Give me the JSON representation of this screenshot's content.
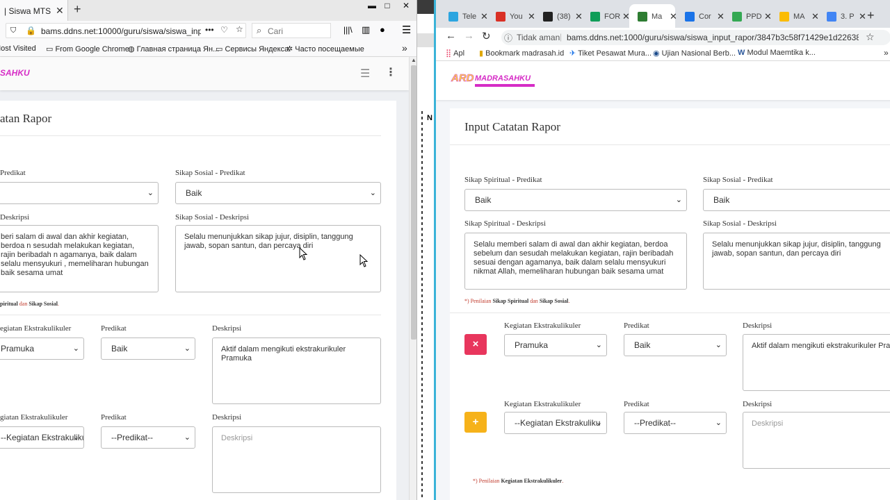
{
  "firefox": {
    "tab_title": "| Siswa MTS",
    "url": "bams.ddns.net:10000/guru/siswa/siswa_input_",
    "search_placeholder": "Cari",
    "bookmarks": [
      "Most Visited",
      "From Google Chrome",
      "Главная страница Ян...",
      "Сервисы Яндекса",
      "Часто посещаемые"
    ],
    "logo": "SAHKU",
    "page_title": "atan Rapor",
    "label_spiritual_predikat": "Predikat",
    "label_sosial_predikat": "Sikap Sosial - Predikat",
    "sosial_predikat_value": "Baik",
    "label_spiritual_deskripsi": "Deskripsi",
    "label_sosial_deskripsi": "Sikap Sosial - Deskripsi",
    "spiritual_deskripsi": "beri salam di awal dan akhir kegiatan, berdoa n sesudah melakukan kegiatan, rajin beribadah n agamanya, baik dalam selalu mensyukuri , memeliharan hubungan baik sesama umat",
    "sosial_deskripsi": "Selalu menunjukkan sikap jujur, disiplin, tanggung jawab, sopan santun, dan percaya diri",
    "note_sikap_bold": "piritual",
    "note_sikap_mid": " dan ",
    "note_sikap_bold2": "Sikap Sosial",
    "note_sikap_end": ".",
    "ekskul_rows": [
      {
        "label_kegiatan": "egiatan Ekstrakulikuler",
        "label_predikat": "Predikat",
        "label_deskripsi": "Deskripsi",
        "kegiatan": "Pramuka",
        "predikat": "Baik",
        "deskripsi": "Aktif dalam mengikuti ekstrakurikuler Pramuka"
      },
      {
        "label_kegiatan": "giatan Ekstrakulikuler",
        "label_predikat": "Predikat",
        "label_deskripsi": "Deskripsi",
        "kegiatan": "--Kegiatan Ekstrakuliku",
        "predikat": "--Predikat--",
        "deskripsi_placeholder": "Deskripsi"
      }
    ]
  },
  "chrome": {
    "tabs": [
      {
        "label": "Tele",
        "color": "#2ca5e0"
      },
      {
        "label": "You",
        "color": "#d93025"
      },
      {
        "label": "(38)",
        "color": "#222222"
      },
      {
        "label": "FOR",
        "color": "#0f9d58"
      },
      {
        "label": "Ma",
        "color": "#2e7d32"
      },
      {
        "label": "Cor",
        "color": "#1a73e8"
      },
      {
        "label": "PPD",
        "color": "#34a853"
      },
      {
        "label": "MA",
        "color": "#fbbc04"
      },
      {
        "label": "3. P",
        "color": "#4285f4"
      }
    ],
    "omnibox_security": "Tidak aman",
    "url": "bams.ddns.net:1000/guru/siswa/siswa_input_rapor/3847b3c58f71429e1d22638633a...",
    "bookmarks": [
      "Apl",
      "Bookmark madrasah.id",
      "Tiket Pesawat Mura...",
      "Ujian Nasional Berb...",
      "Modul Maemtika k..."
    ],
    "logo_main": "ARD",
    "logo_sub": "MADRASAHKU",
    "page_title": "Input Catatan Rapor",
    "label_spiritual_predikat": "Sikap Spiritual - Predikat",
    "spiritual_predikat_value": "Baik",
    "label_sosial_predikat": "Sikap Sosial - Predikat",
    "sosial_predikat_value": "Baik",
    "label_spiritual_deskripsi": "Sikap Spiritual - Deskripsi",
    "spiritual_deskripsi": "Selalu memberi salam di awal dan akhir kegiatan, berdoa sebelum dan sesudah melakukan kegiatan, rajin beribadah sesuai dengan agamanya, baik dalam selalu mensyukuri nikmat Allah, memeliharan hubungan baik sesama umat",
    "label_sosial_deskripsi": "Sikap Sosial - Deskripsi",
    "sosial_deskripsi": "Selalu menunjukkan sikap jujur, disiplin, tanggung jawab, sopan santun, dan percaya diri",
    "note_sikap_prefix": "*) Penilaian ",
    "note_sikap_bold": "Sikap Spiritual",
    "note_sikap_mid": " dan ",
    "note_sikap_bold2": "Sikap Sosial",
    "note_sikap_end": ".",
    "ekskul_rows": [
      {
        "button": "×",
        "label_kegiatan": "Kegiatan Ekstrakulikuler",
        "label_predikat": "Predikat",
        "label_deskripsi": "Deskripsi",
        "kegiatan": "Pramuka",
        "predikat": "Baik",
        "deskripsi": "Aktif dalam mengikuti ekstrakurikuler Pramuka"
      },
      {
        "button": "+",
        "label_kegiatan": "Kegiatan Ekstrakulikuler",
        "label_predikat": "Predikat",
        "label_deskripsi": "Deskripsi",
        "kegiatan": "--Kegiatan Ekstrakuliku",
        "predikat": "--Predikat--",
        "deskripsi_placeholder": "Deskripsi"
      }
    ],
    "note_ekskul_prefix": "*) Penilaian ",
    "note_ekskul_bold": "Kegiatan Ekstrakulikuler",
    "note_ekskul_end": "."
  },
  "colors": {
    "danger": "#e8365d",
    "warning": "#f6b21a",
    "logo_magenta": "#d62cc6"
  }
}
